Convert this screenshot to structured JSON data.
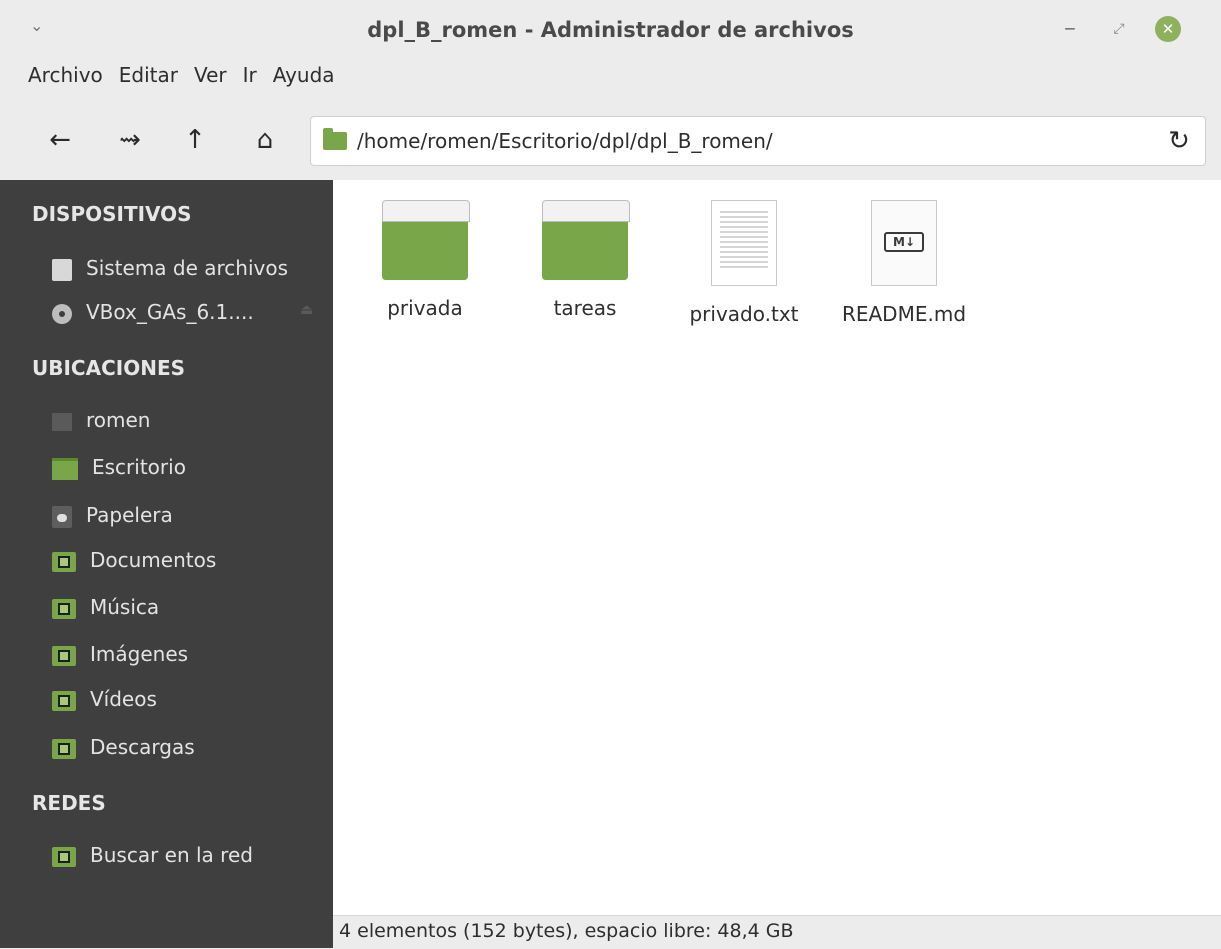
{
  "window": {
    "title": "dpl_B_romen - Administrador de archivos",
    "minimize_glyph": "‒",
    "maximize_glyph": "⤢",
    "close_glyph": "✕",
    "accent_color": "#8fb15d"
  },
  "menubar": {
    "items": [
      "Archivo",
      "Editar",
      "Ver",
      "Ir",
      "Ayuda"
    ]
  },
  "toolbar": {
    "back_icon": "←",
    "forward_icon": "⇝",
    "up_icon": "↑",
    "home_icon": "⌂",
    "path": "/home/romen/Escritorio/dpl/dpl_B_romen/",
    "reload_icon": "↻"
  },
  "sidebar": {
    "devices_header": "DISPOSITIVOS",
    "devices": [
      {
        "label": "Sistema de archivos",
        "icon": "hard-drive-icon"
      },
      {
        "label": "VBox_GAs_6.1....",
        "icon": "optical-disc-icon"
      }
    ],
    "places_header": "UBICACIONES",
    "places": [
      {
        "label": "romen",
        "icon": "home-folder-icon"
      },
      {
        "label": "Escritorio",
        "icon": "desktop-icon"
      },
      {
        "label": "Papelera",
        "icon": "trash-icon"
      },
      {
        "label": "Documentos",
        "icon": "documents-folder-icon"
      },
      {
        "label": "Música",
        "icon": "music-folder-icon"
      },
      {
        "label": "Imágenes",
        "icon": "pictures-folder-icon"
      },
      {
        "label": "Vídeos",
        "icon": "videos-folder-icon"
      },
      {
        "label": "Descargas",
        "icon": "downloads-folder-icon"
      }
    ],
    "network_header": "REDES",
    "network": [
      {
        "label": "Buscar en la red",
        "icon": "network-folder-icon"
      }
    ]
  },
  "files": [
    {
      "name": "privada",
      "type": "folder"
    },
    {
      "name": "tareas",
      "type": "folder"
    },
    {
      "name": "privado.txt",
      "type": "text"
    },
    {
      "name": "README.md",
      "type": "markdown",
      "badge": "M↓"
    }
  ],
  "status": {
    "text": "4 elementos (152 bytes), espacio libre: 48,4 GB"
  }
}
